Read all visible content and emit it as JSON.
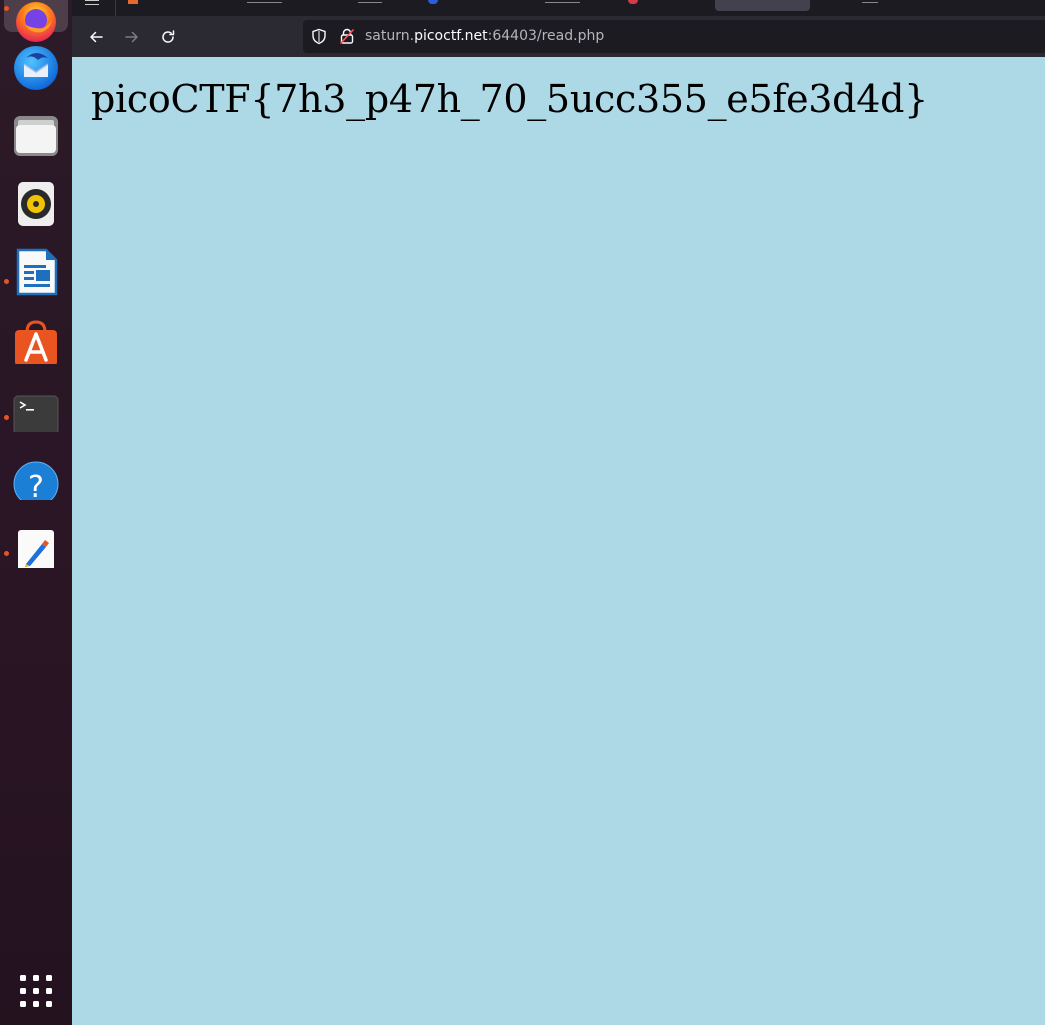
{
  "browser": {
    "url": {
      "prefix": "saturn.",
      "host": "picoctf.net",
      "suffix": ":64403/read.php"
    }
  },
  "page": {
    "flag_text": "picoCTF{7h3_p47h_70_5ucc355_e5fe3d4d}",
    "background_color": "#add8e6"
  },
  "dock": {
    "items": [
      {
        "name": "firefox-icon",
        "running": true,
        "active": true
      },
      {
        "name": "thunderbird-icon",
        "running": false
      },
      {
        "name": "files-icon",
        "running": false
      },
      {
        "name": "rhythmbox-icon",
        "running": false
      },
      {
        "name": "libreoffice-writer-icon",
        "running": true
      },
      {
        "name": "app-center-icon",
        "running": false
      },
      {
        "name": "terminal-icon",
        "running": true
      },
      {
        "name": "help-icon",
        "running": false
      },
      {
        "name": "text-editor-icon",
        "running": true
      }
    ],
    "apps_grid": "show-apps-icon",
    "accent_color": "#e95420"
  }
}
